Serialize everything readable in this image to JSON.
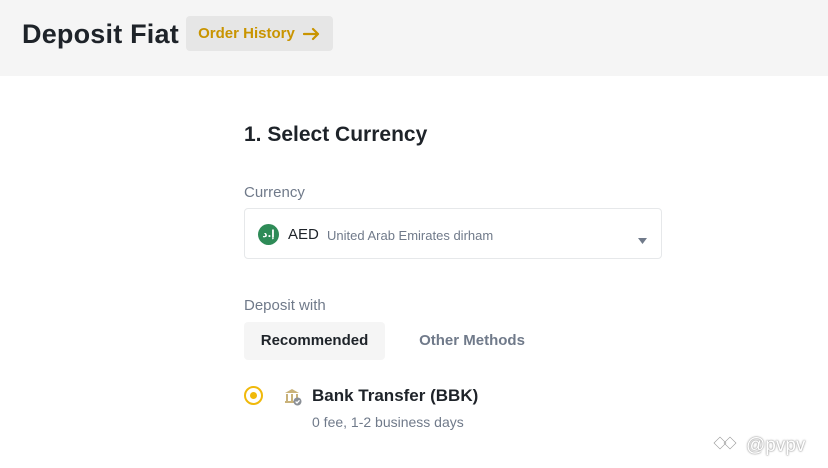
{
  "header": {
    "title": "Deposit Fiat",
    "order_history_label": "Order History",
    "arrow_icon": "arrow-right-icon"
  },
  "section": {
    "title": "1. Select Currency"
  },
  "currency": {
    "label": "Currency",
    "flag_text": "إ.د",
    "code": "AED",
    "name": "United Arab Emirates dirham",
    "caret_icon": "caret-down-icon"
  },
  "deposit": {
    "label": "Deposit with",
    "tabs": [
      {
        "label": "Recommended",
        "selected": true
      },
      {
        "label": "Other Methods",
        "selected": false
      }
    ],
    "method": {
      "name": "Bank Transfer (BBK)",
      "detail": "0 fee, 1-2 business days",
      "selected": true,
      "icon": "bank-icon"
    }
  },
  "watermark": {
    "text": "@pvpv"
  },
  "colors": {
    "accent": "#F0B90B",
    "accent_text": "#C99400",
    "muted": "#707A8A",
    "primary_text": "#1E2329",
    "flag_bg": "#2E8B57"
  }
}
